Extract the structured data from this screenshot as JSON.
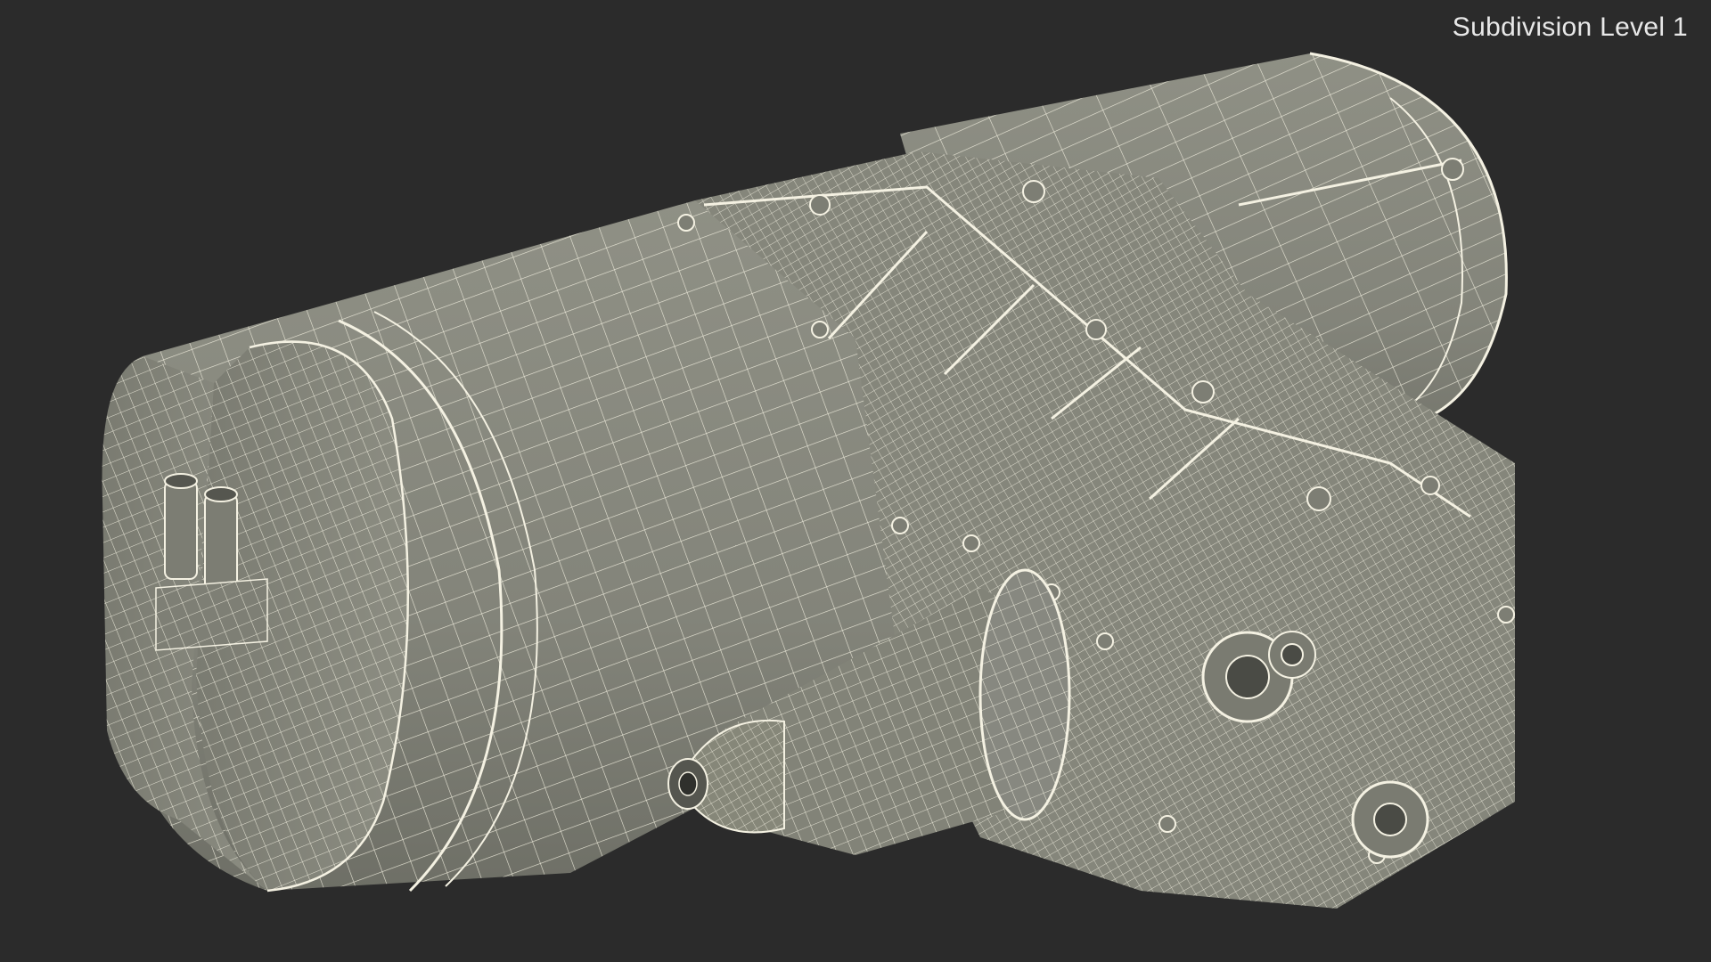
{
  "viewport": {
    "subdivision_label": "Subdivision Level 1",
    "background_color": "#2b2b2b",
    "model_color": "#8a8b80",
    "wire_color": "#f4f1e2"
  }
}
